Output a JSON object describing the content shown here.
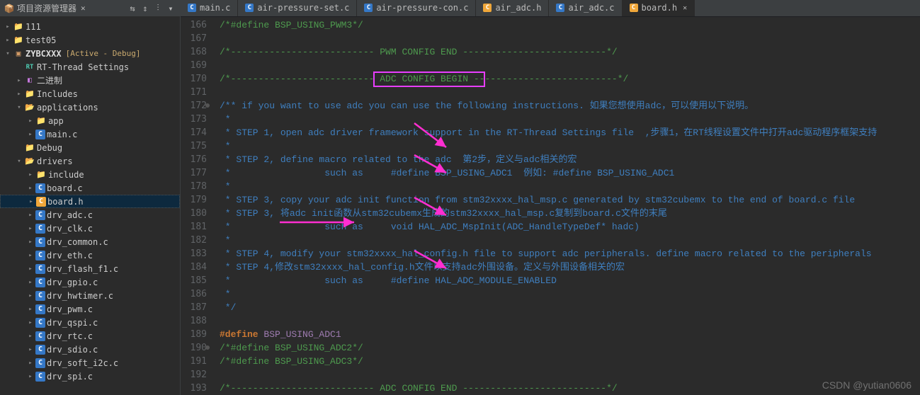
{
  "sidebar": {
    "header": {
      "title": "项目资源管理器",
      "close": "✕",
      "icons": [
        "⇆",
        "⇕",
        "⫶",
        "▾"
      ]
    },
    "tree": [
      {
        "depth": 0,
        "arrow": "▸",
        "icon": "folder",
        "label": "111"
      },
      {
        "depth": 0,
        "arrow": "▸",
        "icon": "folder",
        "label": "test05"
      },
      {
        "depth": 0,
        "arrow": "▾",
        "icon": "projicon",
        "label": "ZYBCXXX",
        "suffix": "[Active - Debug]",
        "bold": true
      },
      {
        "depth": 1,
        "arrow": "",
        "icon": "rt",
        "label": "RT-Thread Settings"
      },
      {
        "depth": 1,
        "arrow": "▸",
        "icon": "bin",
        "label": "二进制"
      },
      {
        "depth": 1,
        "arrow": "▸",
        "icon": "folder",
        "label": "Includes"
      },
      {
        "depth": 1,
        "arrow": "▾",
        "icon": "folder-open",
        "label": "applications"
      },
      {
        "depth": 2,
        "arrow": "▸",
        "icon": "folder",
        "label": "app"
      },
      {
        "depth": 2,
        "arrow": "▸",
        "icon": "cfile",
        "label": "main.c"
      },
      {
        "depth": 1,
        "arrow": "",
        "icon": "folder",
        "label": "Debug"
      },
      {
        "depth": 1,
        "arrow": "▾",
        "icon": "folder-open",
        "label": "drivers"
      },
      {
        "depth": 2,
        "arrow": "▸",
        "icon": "folder",
        "label": "include"
      },
      {
        "depth": 2,
        "arrow": "▸",
        "icon": "cfile",
        "label": "board.c"
      },
      {
        "depth": 2,
        "arrow": "▸",
        "icon": "cfile-orange",
        "label": "board.h",
        "selected": true
      },
      {
        "depth": 2,
        "arrow": "▸",
        "icon": "cfile",
        "label": "drv_adc.c"
      },
      {
        "depth": 2,
        "arrow": "▸",
        "icon": "cfile",
        "label": "drv_clk.c"
      },
      {
        "depth": 2,
        "arrow": "▸",
        "icon": "cfile",
        "label": "drv_common.c"
      },
      {
        "depth": 2,
        "arrow": "▸",
        "icon": "cfile",
        "label": "drv_eth.c"
      },
      {
        "depth": 2,
        "arrow": "▸",
        "icon": "cfile",
        "label": "drv_flash_f1.c"
      },
      {
        "depth": 2,
        "arrow": "▸",
        "icon": "cfile",
        "label": "drv_gpio.c"
      },
      {
        "depth": 2,
        "arrow": "▸",
        "icon": "cfile",
        "label": "drv_hwtimer.c"
      },
      {
        "depth": 2,
        "arrow": "▸",
        "icon": "cfile",
        "label": "drv_pwm.c"
      },
      {
        "depth": 2,
        "arrow": "▸",
        "icon": "cfile",
        "label": "drv_qspi.c"
      },
      {
        "depth": 2,
        "arrow": "▸",
        "icon": "cfile",
        "label": "drv_rtc.c"
      },
      {
        "depth": 2,
        "arrow": "▸",
        "icon": "cfile",
        "label": "drv_sdio.c"
      },
      {
        "depth": 2,
        "arrow": "▸",
        "icon": "cfile",
        "label": "drv_soft_i2c.c"
      },
      {
        "depth": 2,
        "arrow": "▸",
        "icon": "cfile",
        "label": "drv_spi.c"
      }
    ]
  },
  "tabs": [
    {
      "icon": "cfile",
      "label": "main.c",
      "active": false
    },
    {
      "icon": "cfile",
      "label": "air-pressure-set.c",
      "active": false
    },
    {
      "icon": "cfile",
      "label": "air-pressure-con.c",
      "active": false
    },
    {
      "icon": "cfile-orange",
      "label": "air_adc.h",
      "active": false
    },
    {
      "icon": "cfile",
      "label": "air_adc.c",
      "active": false
    },
    {
      "icon": "cfile-orange",
      "label": "board.h",
      "active": true,
      "close": "✕"
    }
  ],
  "code": {
    "start": 166,
    "mark_lines": [
      172,
      190
    ],
    "lines": [
      {
        "n": 166,
        "cls": "comment-gr",
        "t": "/*#define BSP_USING_PWM3*/"
      },
      {
        "n": 167,
        "cls": "",
        "t": ""
      },
      {
        "n": 168,
        "cls": "comment-gr",
        "t": "/*-------------------------- PWM CONFIG END --------------------------*/"
      },
      {
        "n": 169,
        "cls": "",
        "t": ""
      },
      {
        "n": 170,
        "cls": "comment-gr",
        "t": "/*-------------------------- ADC CONFIG BEGIN --------------------------*/"
      },
      {
        "n": 171,
        "cls": "",
        "t": ""
      },
      {
        "n": 172,
        "cls": "comment",
        "t": "/** if you want to use adc you can use the following instructions. 如果您想使用adc，可以使用以下说明。"
      },
      {
        "n": 173,
        "cls": "comment",
        "t": " *"
      },
      {
        "n": 174,
        "cls": "comment",
        "t": " * STEP 1, open adc driver framework support in the RT-Thread Settings file  ,步骤1，在RT线程设置文件中打开adc驱动程序框架支持"
      },
      {
        "n": 175,
        "cls": "comment",
        "t": " *"
      },
      {
        "n": 176,
        "cls": "comment",
        "t": " * STEP 2, define macro related to the adc  第2步，定义与adc相关的宏"
      },
      {
        "n": 177,
        "cls": "comment",
        "t": " *                 such as     #define BSP_USING_ADC1  例如: #define BSP_USING_ADC1"
      },
      {
        "n": 178,
        "cls": "comment",
        "t": " *"
      },
      {
        "n": 179,
        "cls": "comment",
        "t": " * STEP 3, copy your adc init function from stm32xxxx_hal_msp.c generated by stm32cubemx to the end of board.c file"
      },
      {
        "n": 180,
        "cls": "comment",
        "t": " * STEP 3, 将adc init函数从stm32cubemx生成的stm32xxxx_hal_msp.c复制到board.c文件的末尾"
      },
      {
        "n": 181,
        "cls": "comment",
        "t": " *                 such as     void HAL_ADC_MspInit(ADC_HandleTypeDef* hadc)"
      },
      {
        "n": 182,
        "cls": "comment",
        "t": " *"
      },
      {
        "n": 183,
        "cls": "comment",
        "t": " * STEP 4, modify your stm32xxxx_hal_config.h file to support adc peripherals. define macro related to the peripherals"
      },
      {
        "n": 184,
        "cls": "comment",
        "t": " * STEP 4,修改stm32xxxx_hal_config.h文件以支持adc外围设备。定义与外围设备相关的宏"
      },
      {
        "n": 185,
        "cls": "comment",
        "t": " *                 such as     #define HAL_ADC_MODULE_ENABLED"
      },
      {
        "n": 186,
        "cls": "comment",
        "t": " *"
      },
      {
        "n": 187,
        "cls": "comment",
        "t": " */"
      },
      {
        "n": 188,
        "cls": "",
        "t": ""
      },
      {
        "n": 189,
        "cls": "",
        "html": "<span class='keyword'>#define</span> <span style='color:#9e7bb0'>BSP_USING_ADC1</span>"
      },
      {
        "n": 190,
        "cls": "comment-gr",
        "t": "/*#define BSP_USING_ADC2*/"
      },
      {
        "n": 191,
        "cls": "comment-gr",
        "t": "/*#define BSP_USING_ADC3*/"
      },
      {
        "n": 192,
        "cls": "",
        "t": ""
      },
      {
        "n": 193,
        "cls": "comment-gr",
        "t": "/*-------------------------- ADC CONFIG END --------------------------*/"
      }
    ]
  },
  "watermark": "CSDN @yutian0606"
}
